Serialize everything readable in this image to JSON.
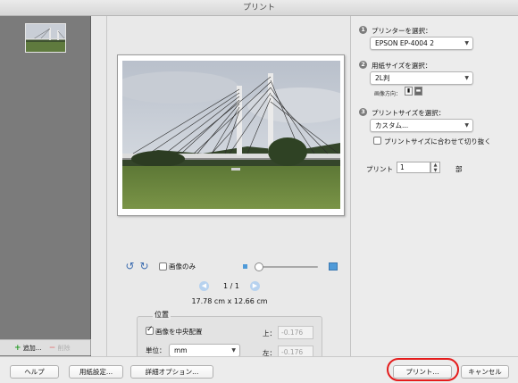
{
  "window": {
    "title": "プリント"
  },
  "thumbnails": {
    "add_label": "追加...",
    "remove_label": "削除"
  },
  "preview": {
    "image_only_label": "画像のみ",
    "page_indicator": "1 / 1",
    "dimensions": "17.78 cm x 12.66 cm",
    "zoom_level": 0
  },
  "position": {
    "title": "位置",
    "center_label": "画像を中央配置",
    "center_checked": true,
    "unit_label": "単位：",
    "unit_value": "mm",
    "top_label": "上：",
    "top_value": "-0.176",
    "left_label": "左：",
    "left_value": "-0.176"
  },
  "settings": {
    "step1": {
      "number": "1",
      "label": "プリンターを選択：",
      "value": "EPSON EP-4004 2"
    },
    "step2": {
      "number": "2",
      "label": "用紙サイズを選択：",
      "value": "2L判",
      "orientation_label": "画像方向："
    },
    "step3": {
      "number": "3",
      "label": "プリントサイズを選択：",
      "value": "カスタム...",
      "fit_label": "プリントサイズに合わせて切り抜く"
    },
    "copies": {
      "label": "プリント",
      "value": "1",
      "unit": "部"
    }
  },
  "buttons": {
    "help": "ヘルプ",
    "page_setup": "用紙設定...",
    "options": "詳細オプション...",
    "print": "プリント...",
    "cancel": "キャンセル"
  },
  "colors": {
    "accent": "#4f9ad8",
    "highlight": "#e41c1c"
  }
}
